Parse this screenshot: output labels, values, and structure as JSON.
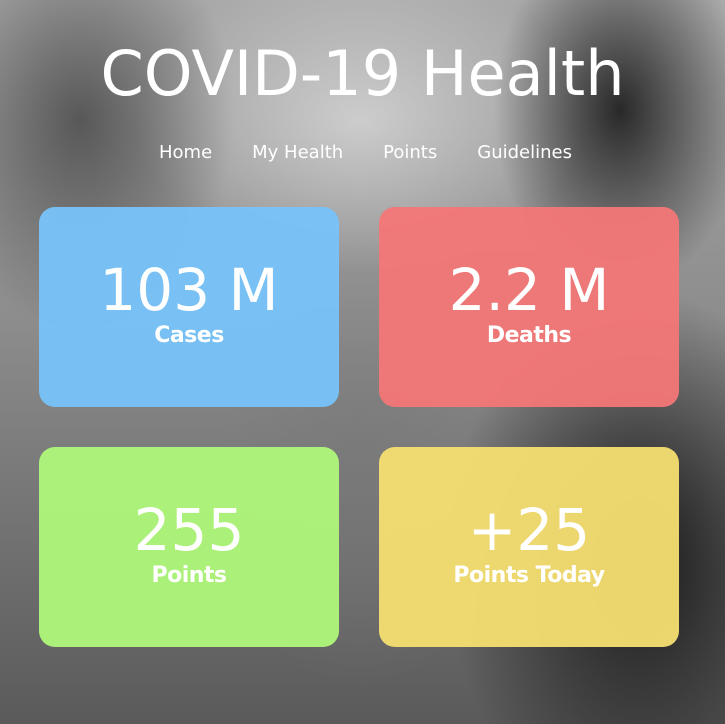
{
  "header": {
    "title": "COVID-19 Health"
  },
  "nav": {
    "items": [
      {
        "label": "Home"
      },
      {
        "label": "My Health"
      },
      {
        "label": "Points"
      },
      {
        "label": "Guidelines"
      }
    ]
  },
  "stats": [
    {
      "value": "103 M",
      "label": "Cases",
      "color": "#78c3f8"
    },
    {
      "value": "2.2 M",
      "label": "Deaths",
      "color": "#f37676"
    },
    {
      "value": "255",
      "label": "Points",
      "color": "#aef67a"
    },
    {
      "value": "+25",
      "label": "Points Today",
      "color": "#f4de70"
    }
  ]
}
